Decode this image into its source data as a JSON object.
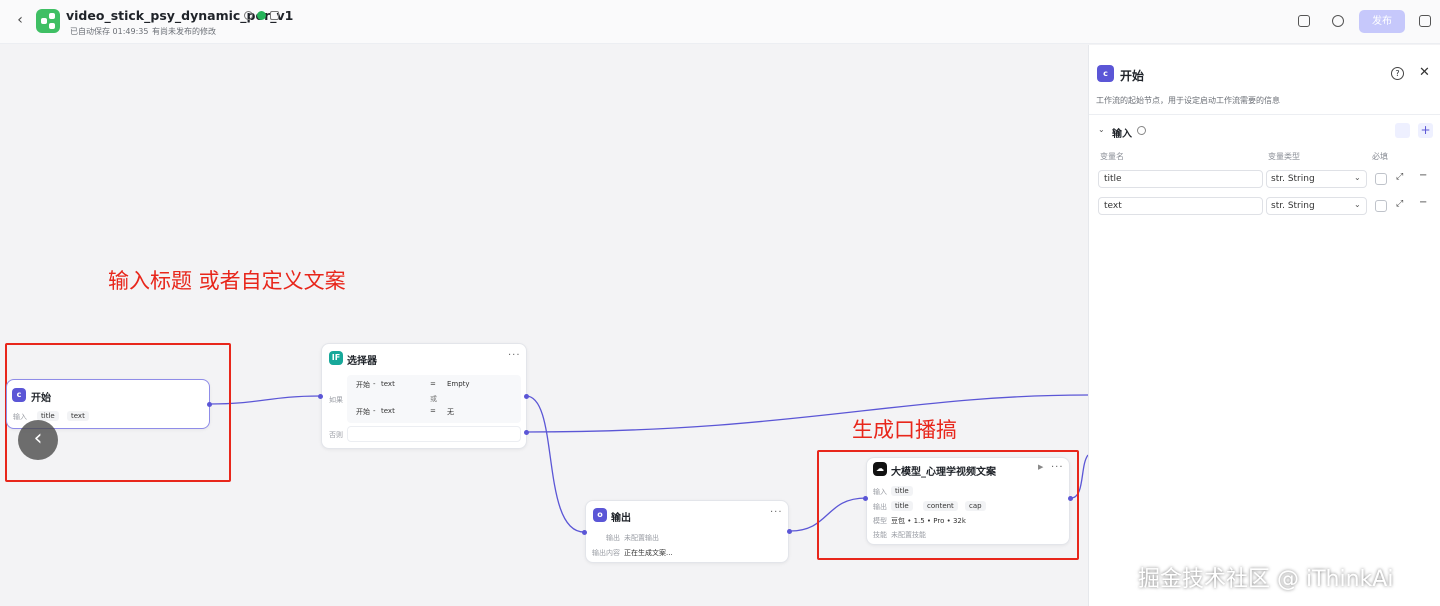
{
  "header": {
    "back_icon": "‹",
    "title": "video_stick_psy_dynamic_por_v1",
    "autosave": "已自动保存 01:49:35",
    "unpublished": "有尚未发布的修改",
    "publish_label": "发布",
    "accent": "#c6c8fb"
  },
  "annotations": {
    "input_note": "输入标题 或者自定义文案",
    "script_note": "生成口播搞"
  },
  "nodes": {
    "start": {
      "title": "开始",
      "input_label": "输入",
      "chips": [
        "title",
        "text"
      ]
    },
    "selector": {
      "title": "选择器",
      "if_label": "如果",
      "else_label": "否则",
      "rows": [
        {
          "source": "开始",
          "sep": "-",
          "var": "text",
          "op": "=",
          "value": "Empty"
        },
        {
          "source": "开始",
          "sep": "-",
          "var": "text",
          "op": "=",
          "value": "无"
        }
      ],
      "or_label": "或",
      "more": "···"
    },
    "output": {
      "title": "输出",
      "output_label": "输出",
      "output_value": "未配置输出",
      "content_label": "输出内容",
      "content_value": "正在生成文案...",
      "more": "···"
    },
    "llm": {
      "title": "大模型_心理学视频文案",
      "input_label": "输入",
      "input_chips": [
        "title"
      ],
      "output_label": "输出",
      "output_chips": [
        "title",
        "content",
        "cap"
      ],
      "model_label": "模型",
      "model_value": "豆包 • 1.5 • Pro • 32k",
      "skill_label": "技能",
      "skill_value": "未配置技能",
      "more": "···"
    }
  },
  "panel": {
    "title": "开始",
    "description": "工作流的起始节点，用于设定启动工作流需要的信息",
    "section": "输入",
    "col_name": "变量名",
    "col_type": "变量类型",
    "col_required": "必填",
    "variables": [
      {
        "name": "title",
        "type": "str. String"
      },
      {
        "name": "text",
        "type": "str. String"
      }
    ]
  },
  "watermark": "掘金技术社区 @ iThinkAi"
}
